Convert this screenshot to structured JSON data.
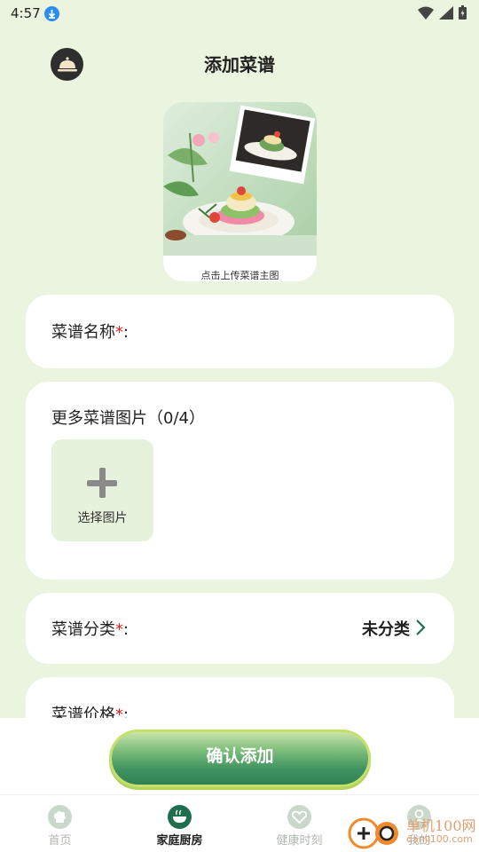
{
  "status_bar": {
    "time": "4:57"
  },
  "header": {
    "title": "添加菜谱"
  },
  "cover": {
    "caption": "点击上传菜谱主图"
  },
  "form": {
    "name": {
      "label": "菜谱名称",
      "required_mark": "*",
      "colon": ":"
    },
    "photos": {
      "label": "更多菜谱图片（0/4）",
      "pick_label": "选择图片"
    },
    "category": {
      "label": "菜谱分类",
      "required_mark": "*",
      "colon": ":",
      "value": "未分类"
    },
    "price": {
      "label": "菜谱价格",
      "required_mark": "*",
      "colon": ":"
    }
  },
  "actions": {
    "confirm_label": "确认添加"
  },
  "tabs": [
    {
      "label": "首页",
      "icon": "chef-hat-icon",
      "active": false
    },
    {
      "label": "家庭厨房",
      "icon": "bowl-icon",
      "active": true
    },
    {
      "label": "健康时刻",
      "icon": "heart-icon",
      "active": false
    },
    {
      "label": "我的",
      "icon": "user-icon",
      "active": false
    }
  ],
  "watermark": {
    "text": "单机100网",
    "sub": "danji100.com"
  },
  "colors": {
    "background": "#eaf4df",
    "accent_green": "#1f6f4e",
    "required": "#e02020"
  }
}
